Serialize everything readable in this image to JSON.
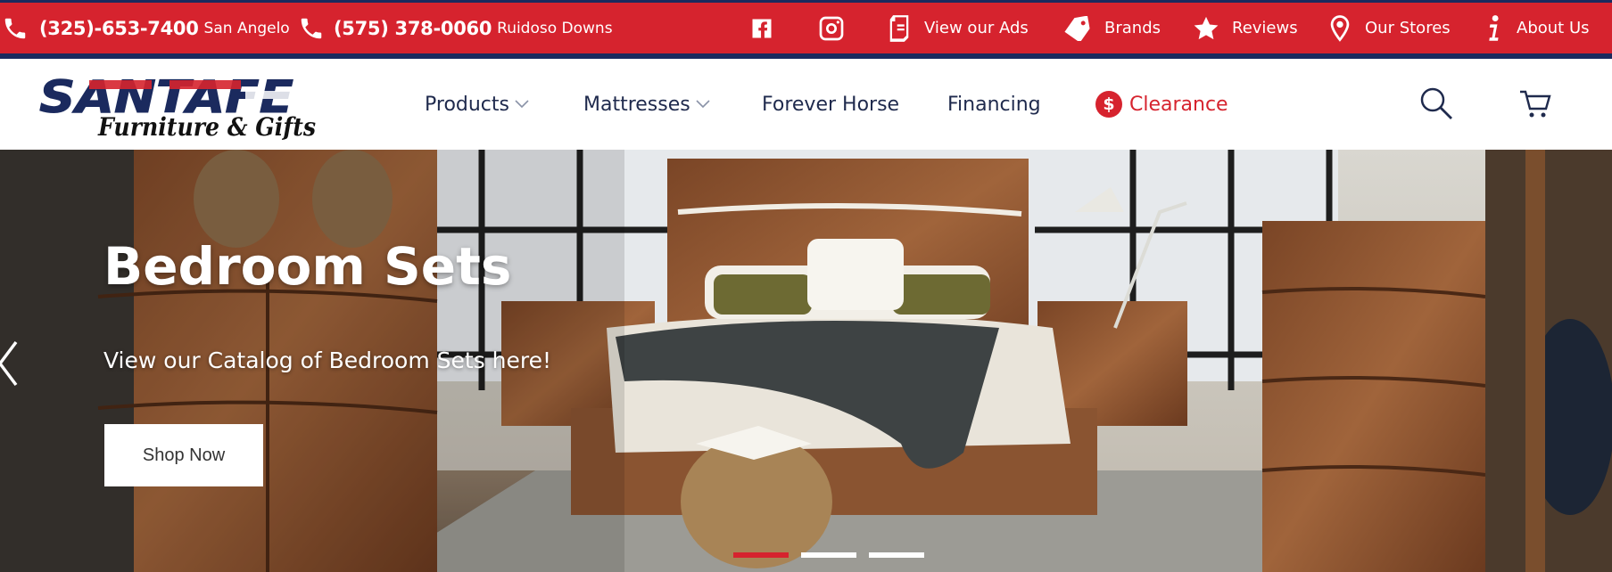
{
  "topbar": {
    "phones": [
      {
        "number": "(325)-653-7400",
        "city": "San Angelo"
      },
      {
        "number": "(575) 378-0060",
        "city": "Ruidoso Downs"
      }
    ],
    "social": [
      {
        "icon": "facebook-icon"
      },
      {
        "icon": "instagram-icon"
      }
    ],
    "links": [
      {
        "label": "View our Ads",
        "icon": "ad-flyer-icon"
      },
      {
        "label": "Brands",
        "icon": "tag-icon"
      },
      {
        "label": "Reviews",
        "icon": "star-icon"
      },
      {
        "label": "Our Stores",
        "icon": "map-pin-icon"
      },
      {
        "label": "About Us",
        "icon": "info-icon"
      }
    ]
  },
  "header": {
    "logo": {
      "brand": "SANTAFE",
      "tagline": "Furniture & Gifts"
    },
    "nav": [
      {
        "label": "Products",
        "has_dropdown": true
      },
      {
        "label": "Mattresses",
        "has_dropdown": true
      },
      {
        "label": "Forever Horse",
        "has_dropdown": false
      },
      {
        "label": "Financing",
        "has_dropdown": false
      },
      {
        "label": "Clearance",
        "has_dropdown": false,
        "icon": "dollar-icon",
        "symbol": "$"
      }
    ],
    "icons": [
      "search-icon",
      "cart-icon"
    ]
  },
  "hero": {
    "title": "Bedroom Sets",
    "subtitle": "View our Catalog of Bedroom Sets here!",
    "cta": "Shop Now",
    "slides_total": 3,
    "active_slide": 1
  },
  "colors": {
    "brand_red": "#d6232e",
    "brand_navy": "#1b2a5e"
  }
}
